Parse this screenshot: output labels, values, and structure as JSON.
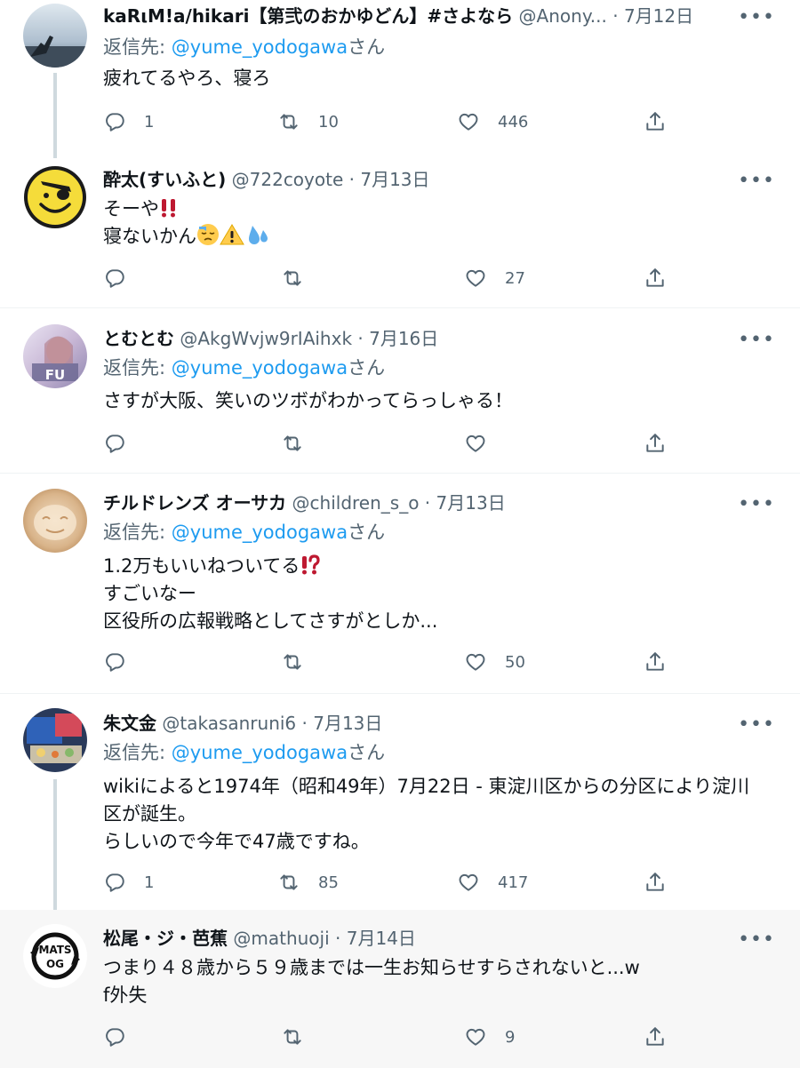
{
  "tweets": [
    {
      "name": "kaRιM!a/hikari【第弐のおかゆどん】#さよなら",
      "handle": "@Anony...",
      "date": "7月12日",
      "reply_prefix": "返信先: ",
      "reply_mention": "@yume_yodogawa",
      "reply_suffix": "さん",
      "lines": [
        "疲れてるやろ、寝ろ"
      ],
      "replies": "1",
      "retweets": "10",
      "likes": "446"
    },
    {
      "name": "酔太(すいふと)",
      "handle": "@722coyote",
      "date": "7月13日",
      "lines": [
        "そーや",
        "寝ないかん"
      ],
      "replies": "",
      "retweets": "",
      "likes": "27"
    },
    {
      "name": "とむとむ",
      "handle": "@AkgWvjw9rIAihxk",
      "date": "7月16日",
      "reply_prefix": "返信先: ",
      "reply_mention": "@yume_yodogawa",
      "reply_suffix": "さん",
      "avatar_text": "FU",
      "lines": [
        "さすが大阪、笑いのツボがわかってらっしゃる！"
      ],
      "replies": "",
      "retweets": "",
      "likes": ""
    },
    {
      "name": "チルドレンズ オーサカ",
      "handle": "@children_s_o",
      "date": "7月13日",
      "reply_prefix": "返信先: ",
      "reply_mention": "@yume_yodogawa",
      "reply_suffix": "さん",
      "lines": [
        "1.2万もいいねついてる",
        "すごいなー",
        "区役所の広報戦略としてさすがとしか..."
      ],
      "replies": "",
      "retweets": "",
      "likes": "50"
    },
    {
      "name": "朱文金",
      "handle": "@takasanruni6",
      "date": "7月13日",
      "reply_prefix": "返信先: ",
      "reply_mention": "@yume_yodogawa",
      "reply_suffix": "さん",
      "lines": [
        "wikiによると1974年（昭和49年）7月22日 - 東淀川区からの分区により淀川",
        "区が誕生。",
        "らしいので今年で47歳ですね。"
      ],
      "replies": "1",
      "retweets": "85",
      "likes": "417"
    },
    {
      "name": "松尾・ジ・芭蕉",
      "handle": "@mathuoji",
      "date": "7月14日",
      "avatar_text_top": "MATS",
      "avatar_text_bottom": "OG",
      "lines": [
        "つまり４８歳から５９歳までは一生お知らせすらされないと...w",
        "f外失"
      ],
      "replies": "",
      "retweets": "",
      "likes": "9"
    }
  ],
  "ui": {
    "more": "•••",
    "dot": "·"
  },
  "colors": {
    "accent": "#1d9bf0",
    "secondary": "#536471",
    "divider": "#eff3f4",
    "thread": "#cfd9de",
    "highlight_bg": "#f7f7f7"
  }
}
